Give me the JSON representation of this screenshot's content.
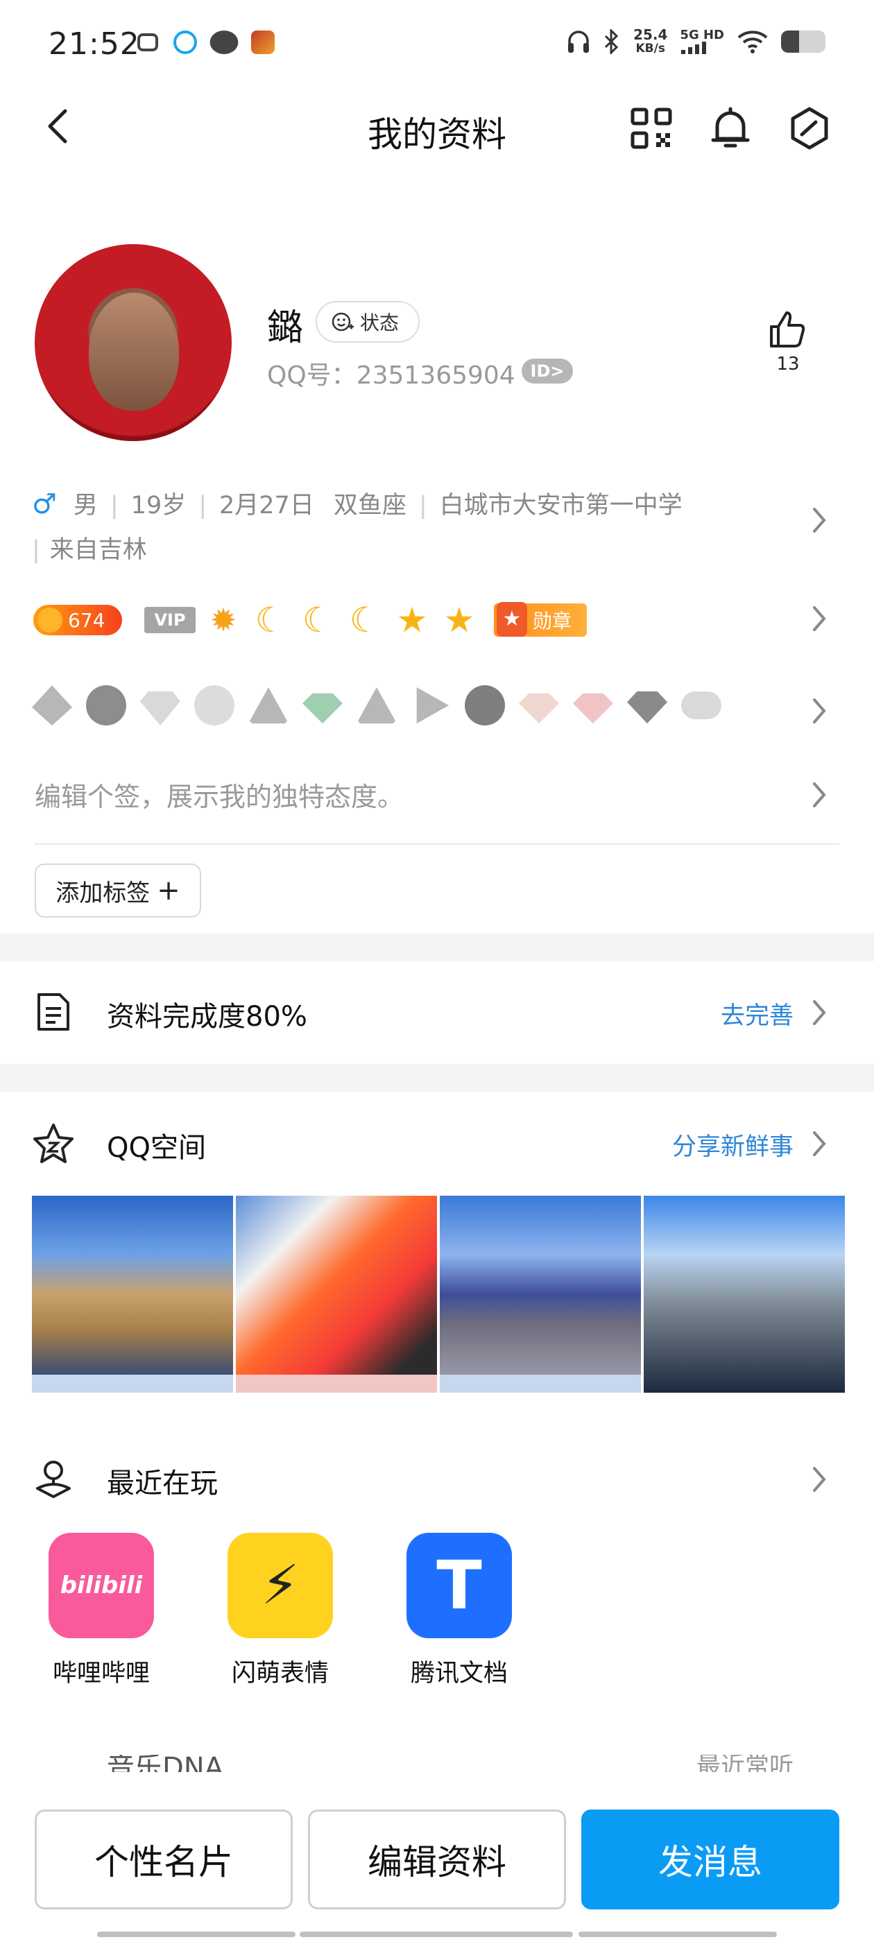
{
  "status_bar": {
    "time": "21:52",
    "speed": "25.4",
    "speed_unit": "KB/s",
    "network": "5G HD"
  },
  "nav": {
    "title": "我的资料",
    "icons": [
      "back-icon",
      "qr-code-icon",
      "bell-icon",
      "settings-hexagon-icon"
    ]
  },
  "profile": {
    "nickname": "鏴",
    "status_label": "状态",
    "qq_number": "QQ号：2351365904",
    "id_badge": "ID>",
    "likes": "13"
  },
  "info": {
    "gender": "男",
    "age": "19岁",
    "birthday": "2月27日",
    "zodiac": "双鱼座",
    "school": "白城市大安市第一中学",
    "hometown": "来自吉林"
  },
  "badges": {
    "coin": "674",
    "vip": "VIP",
    "medal": "勋章"
  },
  "signature_placeholder": "编辑个签，展示我的独特态度。",
  "add_tag": "添加标签",
  "completion": {
    "label": "资料完成度80%",
    "action": "去完善"
  },
  "qzone": {
    "label": "QQ空间",
    "action": "分享新鲜事"
  },
  "recent_play": {
    "label": "最近在玩",
    "apps": [
      {
        "name": "哔哩哔哩",
        "icon_text": "bilibili",
        "color": "#f85a9b"
      },
      {
        "name": "闪萌表情",
        "icon_text": "⚡",
        "color": "#ffd21f"
      },
      {
        "name": "腾讯文档",
        "icon_text": "T",
        "color": "#1e6fff"
      }
    ]
  },
  "music": {
    "label": "音乐DNA",
    "action": "最近常听"
  },
  "bottom_buttons": {
    "card": "个性名片",
    "edit": "编辑资料",
    "message": "发消息"
  },
  "colors": {
    "accent": "#0a9bf5",
    "link": "#2f86d8",
    "male": "#2a90e6"
  }
}
